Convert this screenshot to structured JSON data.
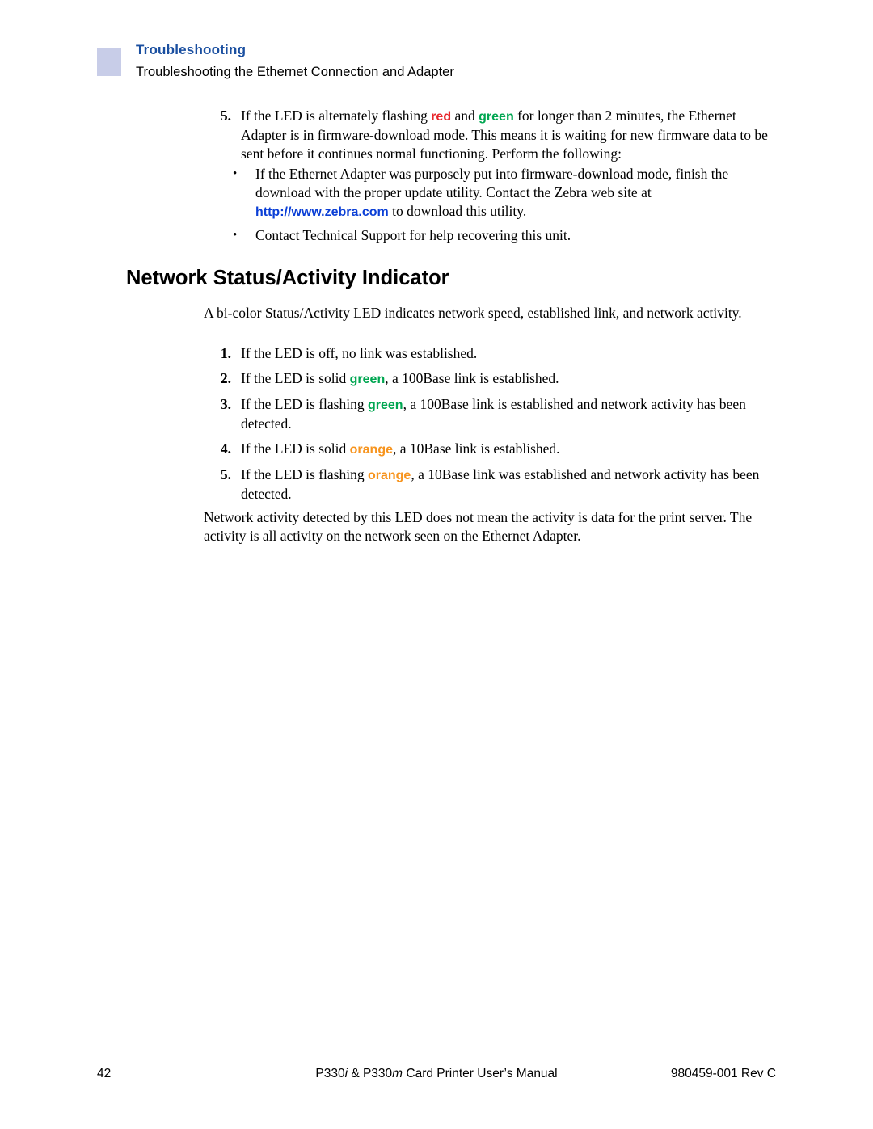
{
  "header": {
    "title": "Troubleshooting",
    "subtitle": "Troubleshooting the Ethernet Connection and Adapter"
  },
  "item5": {
    "marker": "5.",
    "text_a": "If the LED is alternately flashing ",
    "red": "red",
    "text_b": " and ",
    "green": "green",
    "text_c": " for longer than 2 minutes, the Ethernet Adapter is in firmware-download mode. This means it is waiting for new firmware data to be sent before it continues normal functioning. Perform the following:"
  },
  "bullets": [
    {
      "marker": "•",
      "text_a": "If the Ethernet Adapter was purposely put into firmware-download mode, finish the download with the proper update utility. Contact the Zebra web site at ",
      "link": "http://www.zebra.com",
      "text_b": " to download this utility."
    },
    {
      "marker": "•",
      "text_a": "Contact Technical Support for help recovering this unit.",
      "link": "",
      "text_b": ""
    }
  ],
  "section": {
    "title": "Network Status/Activity Indicator",
    "intro": "A bi-color Status/Activity LED indicates network speed, established link, and network activity.",
    "closing": "Network activity detected by this LED does not mean the activity is data for the print server. The activity is all activity on the network seen on the Ethernet Adapter."
  },
  "led_list": [
    {
      "marker": "1.",
      "text_a": "If the LED is off, no link was established.",
      "color_word": "",
      "color_class": "",
      "text_b": ""
    },
    {
      "marker": "2.",
      "text_a": "If the LED is solid ",
      "color_word": "green",
      "color_class": "c-green",
      "text_b": ", a 100Base link is established."
    },
    {
      "marker": "3.",
      "text_a": "If the LED is flashing ",
      "color_word": "green",
      "color_class": "c-green",
      "text_b": ", a 100Base link is established and network activity has been detected."
    },
    {
      "marker": "4.",
      "text_a": "If the LED is solid ",
      "color_word": "orange",
      "color_class": "c-orange",
      "text_b": ", a 10Base link is established."
    },
    {
      "marker": "5.",
      "text_a": "If the LED is flashing ",
      "color_word": "orange",
      "color_class": "c-orange",
      "text_b": ", a 10Base link was established and network activity has been detected."
    }
  ],
  "footer": {
    "page_number": "42",
    "manual_a": "P330",
    "manual_i": "i",
    "manual_b": " & P330",
    "manual_m": "m",
    "manual_c": " Card Printer User’s Manual",
    "part_number": "980459-001",
    "revision": " Rev C"
  },
  "colors": {
    "header_blue": "#1a4fa0",
    "header_bar": "#c8cde8",
    "red": "#e8252b",
    "green": "#00a651",
    "orange": "#f7941e",
    "link_blue": "#0b3fd6"
  }
}
